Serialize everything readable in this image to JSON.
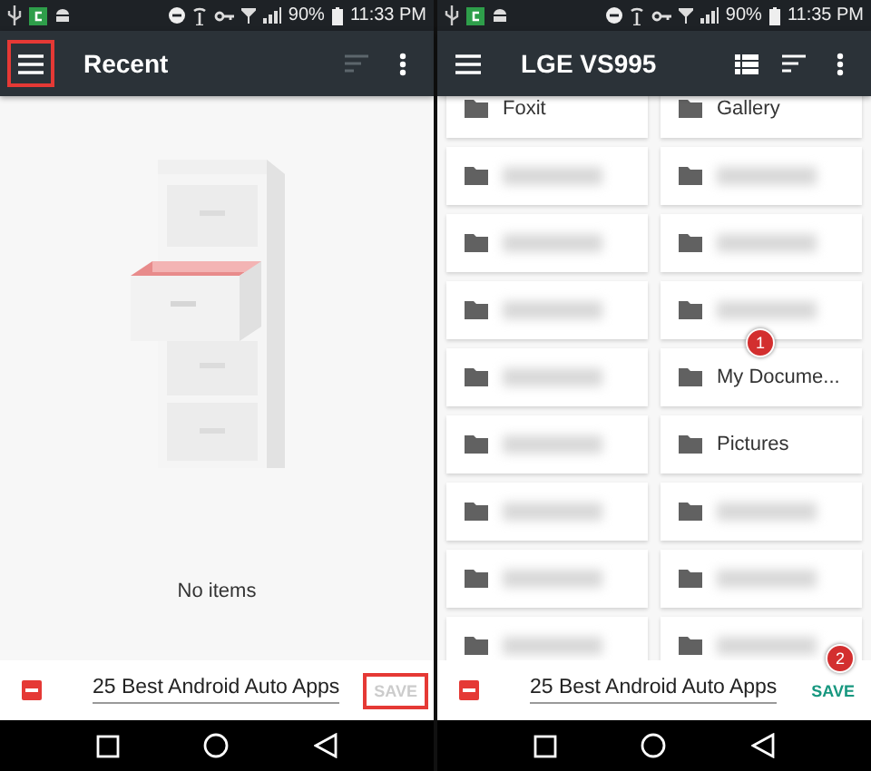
{
  "panels": [
    {
      "status_bar": {
        "battery": "90%",
        "time": "11:33 PM"
      },
      "toolbar": {
        "title": "Recent",
        "menu_highlighted": true,
        "sort_disabled": true,
        "list_view_button": false
      },
      "content": {
        "kind": "empty",
        "message": "No items"
      },
      "save_bar": {
        "filename": "25 Best Android Auto Apps",
        "save_label": "SAVE",
        "save_disabled": true,
        "save_highlighted": true
      }
    },
    {
      "status_bar": {
        "battery": "90%",
        "time": "11:35 PM"
      },
      "toolbar": {
        "title": "LGE VS995",
        "menu_highlighted": false,
        "sort_disabled": false,
        "list_view_button": true
      },
      "content": {
        "kind": "folders",
        "folders": [
          {
            "name": "Foxit",
            "blurred": false
          },
          {
            "name": "Gallery",
            "blurred": false
          },
          {
            "blurred": true
          },
          {
            "blurred": true
          },
          {
            "blurred": true
          },
          {
            "blurred": true
          },
          {
            "blurred": true
          },
          {
            "blurred": true
          },
          {
            "blurred": true
          },
          {
            "name": "My Docume...",
            "blurred": false,
            "callout": "1"
          },
          {
            "blurred": true
          },
          {
            "name": "Pictures",
            "blurred": false
          },
          {
            "blurred": true
          },
          {
            "blurred": true
          },
          {
            "blurred": true
          },
          {
            "blurred": true
          },
          {
            "blurred": true
          },
          {
            "blurred": true
          }
        ]
      },
      "save_bar": {
        "filename": "25 Best Android Auto Apps",
        "save_label": "SAVE",
        "save_disabled": false,
        "save_highlighted": false,
        "callout": "2"
      }
    }
  ]
}
